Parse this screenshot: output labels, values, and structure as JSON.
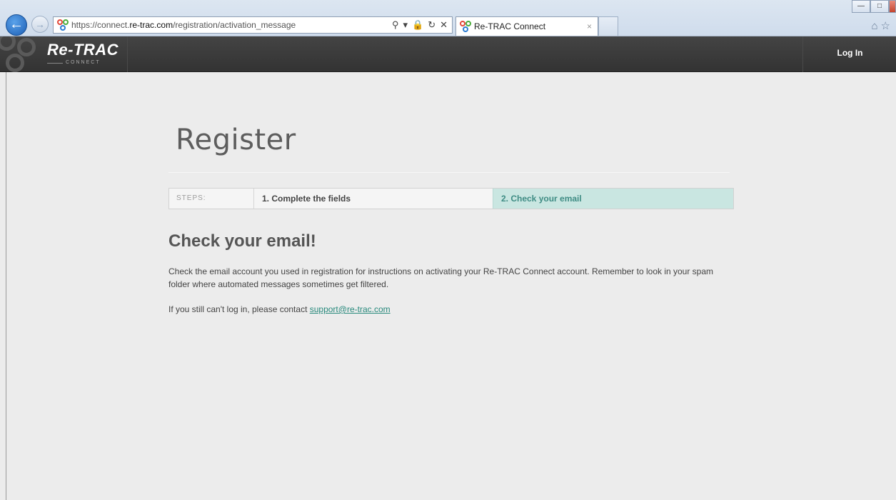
{
  "browser": {
    "url_prefix": "https://connect.",
    "url_domain": "re-trac.com",
    "url_path": "/registration/activation_message",
    "tab_title": "Re-TRAC Connect",
    "tab_close": "×"
  },
  "header": {
    "logo_text": "Re-TRAC",
    "logo_sub": "CONNECT",
    "login_label": "Log In"
  },
  "page": {
    "title": "Register",
    "steps": {
      "label": "STEPS:",
      "step1": "1. Complete the fields",
      "step2": "2. Check your email"
    },
    "heading": "Check your email!",
    "message": "Check the email account you used in registration for instructions on activating your Re-TRAC Connect account. Remember to look in your spam folder where automated messages sometimes get filtered.",
    "support_text": "If you still can't log in, please contact ",
    "support_email": "support@re-trac.com"
  }
}
